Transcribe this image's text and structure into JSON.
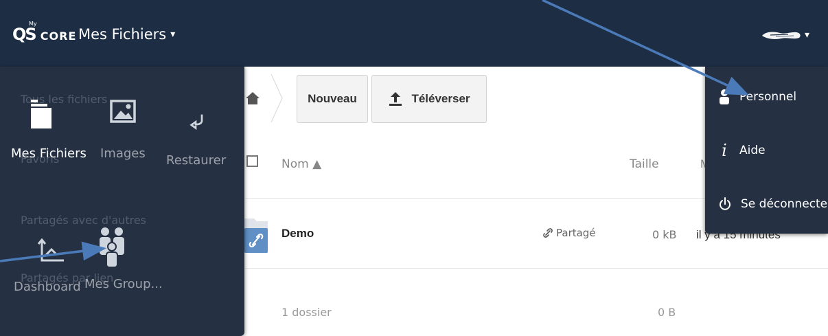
{
  "header": {
    "logo_qs": "QS",
    "logo_my": "My",
    "logo_core": "CORE",
    "app_title": "Mes Fichiers",
    "caret": "▾",
    "user_caret": "▾"
  },
  "toolbar": {
    "new_label": "Nouveau",
    "upload_label": "Téléverser"
  },
  "table": {
    "col_name": "Nom ▲",
    "col_size": "Taille",
    "col_modified": "M",
    "rows": [
      {
        "name": "Demo",
        "share_label": "Partagé",
        "size": "0 kB",
        "modified": "il y a 15 minutes"
      }
    ],
    "summary_count": "1 dossier",
    "summary_size": "0 B"
  },
  "app_menu": {
    "ghost_texts": [
      "Tous les fichiers",
      "Favoris",
      "Partagés avec d'autres",
      "Partagés par lien"
    ],
    "items": [
      {
        "label": "Mes Fichiers",
        "icon": "folder-icon",
        "active": true
      },
      {
        "label": "Images",
        "icon": "image-icon",
        "active": false
      },
      {
        "label": "Restaurer",
        "icon": "restore-icon",
        "active": false
      },
      {
        "label": "Dashboard",
        "icon": "dashboard-icon",
        "active": false
      },
      {
        "label": "Mes Group...",
        "icon": "group-icon",
        "active": false
      }
    ]
  },
  "user_menu": {
    "items": [
      {
        "label": "Personnel",
        "icon": "user-icon"
      },
      {
        "label": "Aide",
        "icon": "info-icon"
      },
      {
        "label": "Se déconnecter",
        "icon": "power-icon"
      }
    ]
  },
  "colors": {
    "header_bg": "#1d2d44",
    "menu_bg": "#253042",
    "annotation_arrow": "#4a7ab8"
  }
}
